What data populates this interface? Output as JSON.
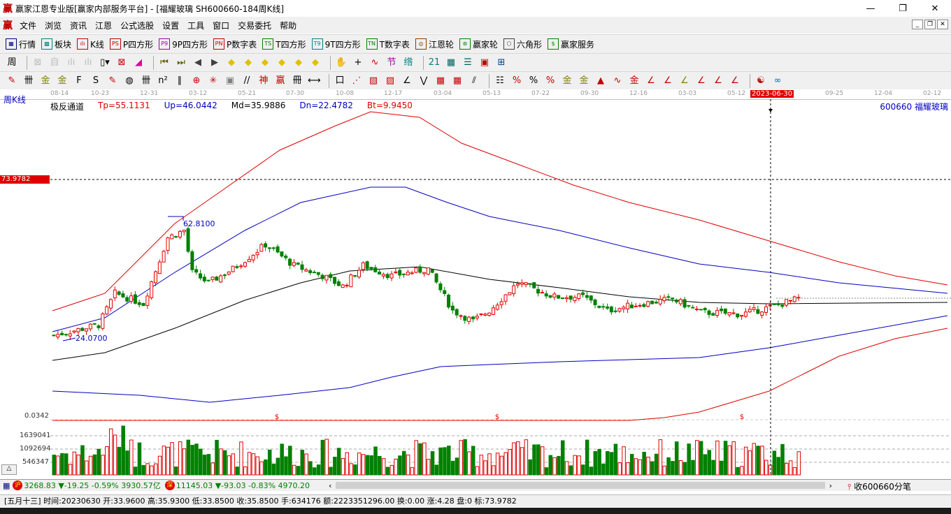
{
  "window": {
    "logo": "赢",
    "title": "赢家江恩专业版[赢家内部服务平台] - [福耀玻璃  SH600660-184周K线]",
    "min": "—",
    "max": "❐",
    "close": "✕"
  },
  "menu": {
    "logo": "赢",
    "items": [
      "文件",
      "浏览",
      "资讯",
      "江恩",
      "公式选股",
      "设置",
      "工具",
      "窗口",
      "交易委托",
      "帮助"
    ]
  },
  "toolbar1": [
    {
      "icon": "grid-icon",
      "glyph": "▦",
      "label": "行情",
      "color": "#000080"
    },
    {
      "icon": "blocks-icon",
      "glyph": "▩",
      "label": "板块",
      "color": "#008080"
    },
    {
      "icon": "candles-icon",
      "glyph": "ılı",
      "label": "K线",
      "color": "#c00000"
    },
    {
      "icon": "ps-icon",
      "glyph": "PS",
      "label": "P四方形",
      "color": "#c00000"
    },
    {
      "icon": "p9-icon",
      "glyph": "P9",
      "label": "9P四方形",
      "color": "#a000a0"
    },
    {
      "icon": "pn-icon",
      "glyph": "PN",
      "label": "P数字表",
      "color": "#c00000"
    },
    {
      "icon": "ts-icon",
      "glyph": "TS",
      "label": "T四方形",
      "color": "#008000"
    },
    {
      "icon": "t9-icon",
      "glyph": "T9",
      "label": "9T四方形",
      "color": "#008080"
    },
    {
      "icon": "tn-icon",
      "glyph": "TN",
      "label": "T数字表",
      "color": "#008000"
    },
    {
      "icon": "gann-wheel-icon",
      "glyph": "◎",
      "label": "江恩轮",
      "color": "#804000"
    },
    {
      "icon": "winner-wheel-icon",
      "glyph": "⊛",
      "label": "赢家轮",
      "color": "#008000"
    },
    {
      "icon": "hexagon-icon",
      "glyph": "⬡",
      "label": "六角形",
      "color": "#404040"
    },
    {
      "icon": "dollar-icon",
      "glyph": "$",
      "label": "赢家服务",
      "color": "#008000"
    }
  ],
  "toolbar2": [
    {
      "icon": "period-week-icon",
      "glyph": "周▾",
      "color": "#000"
    },
    {
      "icon": "disabled-icon",
      "glyph": "⊠",
      "color": "#bbb"
    },
    {
      "icon": "self-icon",
      "glyph": "自",
      "color": "#bbb"
    },
    {
      "icon": "chart3-icon",
      "glyph": "ılı",
      "color": "#bbb"
    },
    {
      "icon": "chart9-icon",
      "glyph": "ılı",
      "color": "#bbb"
    },
    {
      "icon": "candle-type-icon",
      "glyph": "▯▾",
      "color": "#000"
    },
    {
      "icon": "mark-icon",
      "glyph": "⊠",
      "color": "#c00000"
    },
    {
      "icon": "volume-profile-icon",
      "glyph": "◢",
      "color": "#e000a0"
    },
    {
      "icon": "first-icon",
      "glyph": "⏮",
      "color": "#606000"
    },
    {
      "icon": "last-icon",
      "glyph": "⏭",
      "color": "#606000"
    },
    {
      "icon": "prev-icon",
      "glyph": "◀",
      "color": "#404040"
    },
    {
      "icon": "next-icon",
      "glyph": "▶",
      "color": "#404040"
    },
    {
      "icon": "diamond-left-icon",
      "glyph": "◆",
      "color": "#e0c000"
    },
    {
      "icon": "diamond-right-icon",
      "glyph": "◆",
      "color": "#e0c000"
    },
    {
      "icon": "diamond-h-icon",
      "glyph": "◆",
      "color": "#e0c000"
    },
    {
      "icon": "diamond-x-icon",
      "glyph": "◆",
      "color": "#e0c000"
    },
    {
      "icon": "diamond-v-icon",
      "glyph": "◆",
      "color": "#e0c000"
    },
    {
      "icon": "diamond-all-icon",
      "glyph": "◆",
      "color": "#e0c000"
    },
    {
      "icon": "hand-icon",
      "glyph": "✋",
      "color": "#000"
    },
    {
      "icon": "crosshair-icon",
      "glyph": "+",
      "color": "#000"
    },
    {
      "icon": "draw-icon",
      "glyph": "∿",
      "color": "#c00000"
    },
    {
      "icon": "solar-term-icon",
      "glyph": "节",
      "color": "#a000a0"
    },
    {
      "icon": "pattern-icon",
      "glyph": "绺",
      "color": "#008080"
    },
    {
      "icon": "calendar-icon",
      "glyph": "21",
      "color": "#008080"
    },
    {
      "icon": "calculator-icon",
      "glyph": "▦",
      "color": "#006060"
    },
    {
      "icon": "notes-icon",
      "glyph": "☰",
      "color": "#006060"
    },
    {
      "icon": "save-icon",
      "glyph": "▣",
      "color": "#c00000"
    },
    {
      "icon": "network-icon",
      "glyph": "⊞",
      "color": "#004080"
    }
  ],
  "toolbar3": [
    {
      "icon": "pen-icon",
      "glyph": "✎",
      "color": "#c00000"
    },
    {
      "icon": "grid-lines-icon",
      "glyph": "卌",
      "color": "#000"
    },
    {
      "icon": "gold-icon",
      "glyph": "金",
      "color": "#808000"
    },
    {
      "icon": "gold2-icon",
      "glyph": "金",
      "color": "#808000"
    },
    {
      "icon": "f-icon",
      "glyph": "F",
      "color": "#000"
    },
    {
      "icon": "spiral-icon",
      "glyph": "S",
      "color": "#000"
    },
    {
      "icon": "pen2-icon",
      "glyph": "✎",
      "color": "#c00000"
    },
    {
      "icon": "circle-ruler-icon",
      "glyph": "◍",
      "color": "#000"
    },
    {
      "icon": "parallel-icon",
      "glyph": "卌",
      "color": "#000"
    },
    {
      "icon": "n2-icon",
      "glyph": "n²",
      "color": "#000"
    },
    {
      "icon": "fan-icon",
      "glyph": "∥",
      "color": "#000"
    },
    {
      "icon": "target-icon",
      "glyph": "⊕",
      "color": "#c00000"
    },
    {
      "icon": "star-icon",
      "glyph": "✳",
      "color": "#c00000"
    },
    {
      "icon": "box-icon",
      "glyph": "▣",
      "color": "#808080"
    },
    {
      "icon": "lines-icon",
      "glyph": "//",
      "color": "#000"
    },
    {
      "icon": "god-icon",
      "glyph": "神",
      "color": "#c00000"
    },
    {
      "icon": "win-icon",
      "glyph": "赢",
      "color": "#c00000"
    },
    {
      "icon": "ruler-icon",
      "glyph": "冊",
      "color": "#000"
    },
    {
      "icon": "measure-icon",
      "glyph": "⟷",
      "color": "#000"
    },
    {
      "icon": "rect-icon",
      "glyph": "口",
      "color": "#000"
    },
    {
      "icon": "fan-lines-icon",
      "glyph": "⋰",
      "color": "#c00000"
    },
    {
      "icon": "gann-box-icon",
      "glyph": "▧",
      "color": "#c00000"
    },
    {
      "icon": "gann-grid-icon",
      "glyph": "▨",
      "color": "#c00000"
    },
    {
      "icon": "angle-icon",
      "glyph": "∠",
      "color": "#000"
    },
    {
      "icon": "zigzag-icon",
      "glyph": "⋁",
      "color": "#000"
    },
    {
      "icon": "matrix-icon",
      "glyph": "▦",
      "color": "#c00000"
    },
    {
      "icon": "matrix2-icon",
      "glyph": "▦",
      "color": "#c00000"
    },
    {
      "icon": "hatch-icon",
      "glyph": "⫽",
      "color": "#000"
    },
    {
      "icon": "table-icon",
      "glyph": "☷",
      "color": "#000"
    },
    {
      "icon": "pct-fan-icon",
      "glyph": "%",
      "color": "#c00000"
    },
    {
      "icon": "percent-icon",
      "glyph": "%",
      "color": "#000"
    },
    {
      "icon": "pct-lines-icon",
      "glyph": "%",
      "color": "#c00000"
    },
    {
      "icon": "gold-coin-icon",
      "glyph": "金",
      "color": "#808000"
    },
    {
      "icon": "gold-lines-icon",
      "glyph": "金",
      "color": "#808000"
    },
    {
      "icon": "cone-icon",
      "glyph": "▲",
      "color": "#c00000"
    },
    {
      "icon": "wave-icon",
      "glyph": "∿",
      "color": "#c00000"
    },
    {
      "icon": "gold-box-icon",
      "glyph": "金",
      "color": "#c00000"
    },
    {
      "icon": "j-angle-icon",
      "glyph": "∠",
      "color": "#c00000"
    },
    {
      "icon": "f-angle-icon",
      "glyph": "∠",
      "color": "#c00000"
    },
    {
      "icon": "gold-angle-icon",
      "glyph": "∠",
      "color": "#808000"
    },
    {
      "icon": "god-angle-icon",
      "glyph": "∠",
      "color": "#c00000"
    },
    {
      "icon": "win-angle-icon",
      "glyph": "∠",
      "color": "#c00000"
    },
    {
      "icon": "four-angle-icon",
      "glyph": "∠",
      "color": "#c00000"
    },
    {
      "icon": "yinyang-icon",
      "glyph": "☯",
      "color": "#c00000"
    },
    {
      "icon": "infinity-icon",
      "glyph": "∞",
      "color": "#0060c0"
    }
  ],
  "chart": {
    "period_label": "周K线",
    "date_ticks": [
      "08-14",
      "10-23",
      "12-31",
      "03-12",
      "05-21",
      "07-30",
      "10-08",
      "12-17",
      "03-04",
      "05-13",
      "07-22",
      "09-30",
      "12-16",
      "03-03",
      "05-12",
      "09-25",
      "12-04",
      "02-12"
    ],
    "cursor_date": "2023-06-30",
    "indicator": {
      "name": "极反通道",
      "tp": "Tp=55.1131",
      "up": "Up=46.0442",
      "md": "Md=35.9886",
      "dn": "Dn=22.4782",
      "bt": "Bt=9.9450"
    },
    "stock": "600660  福耀玻璃",
    "cursor_price": "73.9782",
    "high_label": "62.8100",
    "low_label": "24.0700",
    "lower_value": "0.0342",
    "volume_ticks": [
      "1639041",
      "1092694",
      "546347"
    ],
    "marker": "$",
    "scroll_up": "△"
  },
  "chart_data": {
    "type": "candlestick",
    "bars": 184,
    "close_keyframes": [
      [
        0,
        24.7
      ],
      [
        11,
        28.0
      ],
      [
        15,
        38
      ],
      [
        22,
        34.7
      ],
      [
        28,
        55.6
      ],
      [
        32,
        57.9
      ],
      [
        34,
        44.6
      ],
      [
        38,
        41.3
      ],
      [
        44,
        45.7
      ],
      [
        52,
        53.4
      ],
      [
        59,
        46.8
      ],
      [
        66,
        43.5
      ],
      [
        71,
        40.2
      ],
      [
        76,
        46.8
      ],
      [
        83,
        43.5
      ],
      [
        92,
        45.7
      ],
      [
        98,
        32.5
      ],
      [
        103,
        29.2
      ],
      [
        107,
        32.5
      ],
      [
        114,
        41.3
      ],
      [
        123,
        36.9
      ],
      [
        130,
        36.9
      ],
      [
        136,
        32.5
      ],
      [
        142,
        34.2
      ],
      [
        152,
        36.2
      ],
      [
        159,
        32.0
      ],
      [
        169,
        31.4
      ],
      [
        176,
        33.6
      ],
      [
        184,
        36.7
      ]
    ],
    "price_ref": 73.9782,
    "high": 62.81,
    "low": 24.07
  },
  "index_bar": {
    "sh_badge": "沪",
    "sh": "3268.83 ▼-19.25 -0.59% 3930.57亿",
    "sz_badge": "深",
    "sz": "11145.03 ▼-93.03 -0.83% 4970.20",
    "scroll_left": "‹",
    "scroll_right": "›",
    "tick_label": "收600660分笔"
  },
  "status": "[五月十三] 时间:20230630 开:33.9600 高:35.9300 低:33.8500 收:35.8500 手:634176 额:2223351296.00 换:0.00 涨:4.28 盘:0 标:73.9782"
}
